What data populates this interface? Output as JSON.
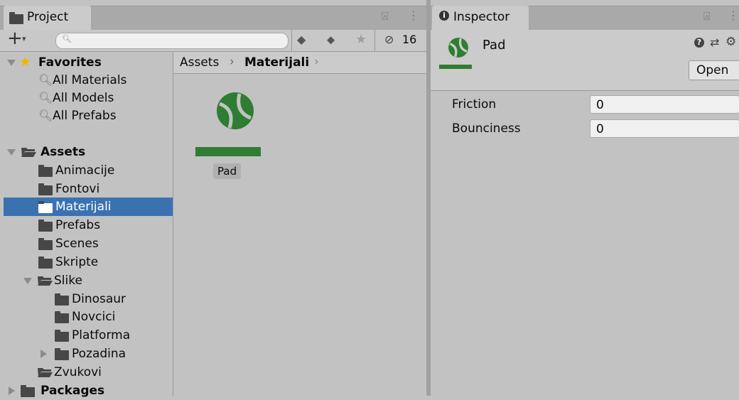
{
  "project_panel": {
    "tab_label": "Project",
    "search_placeholder": "",
    "hidden_count": "16",
    "favorites": {
      "label": "Favorites",
      "items": [
        "All Materials",
        "All Models",
        "All Prefabs"
      ]
    },
    "assets": {
      "label": "Assets",
      "folders": [
        "Animacije",
        "Fontovi",
        "Materijali",
        "Prefabs",
        "Scenes",
        "Skripte"
      ],
      "slike": {
        "label": "Slike",
        "children": [
          "Dinosaur",
          "Novcici",
          "Platforma",
          "Pozadina"
        ]
      },
      "zvukovi": "Zvukovi"
    },
    "packages_label": "Packages",
    "selected_folder": "Materijali"
  },
  "breadcrumb": {
    "root": "Assets",
    "current": "Materijali"
  },
  "asset": {
    "name": "Pad",
    "accent_color": "#2e7d32"
  },
  "inspector": {
    "tab_label": "Inspector",
    "title": "Pad",
    "open_label": "Open",
    "properties": [
      {
        "label": "Friction",
        "value": "0"
      },
      {
        "label": "Bounciness",
        "value": "0"
      }
    ]
  }
}
